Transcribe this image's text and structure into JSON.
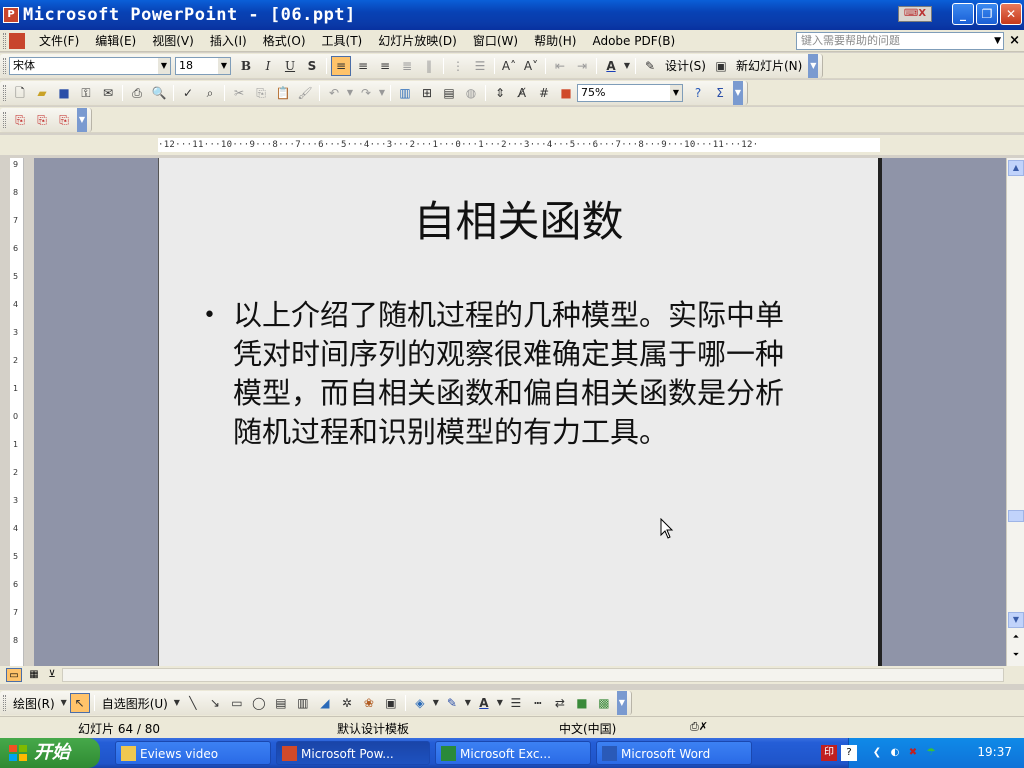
{
  "window": {
    "title": "Microsoft PowerPoint - [06.ppt]",
    "app_icon_label": "P",
    "ime_badge": "⌨X"
  },
  "menu": {
    "items": [
      "文件(F)",
      "编辑(E)",
      "视图(V)",
      "插入(I)",
      "格式(O)",
      "工具(T)",
      "幻灯片放映(D)",
      "窗口(W)",
      "帮助(H)",
      "Adobe PDF(B)"
    ],
    "help_placeholder": "键入需要帮助的问题"
  },
  "format_toolbar": {
    "font": "宋体",
    "size": "18",
    "design_label": "设计(S)",
    "new_slide_label": "新幻灯片(N)"
  },
  "standard_toolbar": {
    "zoom": "75%"
  },
  "ruler": {
    "text": "·12···11···10···9···8···7···6···5···4···3···2···1···0···1···2···3···4···5···6···7···8···9···10···11···12·",
    "vertical_marks": [
      "9",
      "8",
      "7",
      "6",
      "5",
      "4",
      "3",
      "2",
      "1",
      "0",
      "1",
      "2",
      "3",
      "4",
      "5",
      "6",
      "7",
      "8"
    ]
  },
  "slide": {
    "title": "自相关函数",
    "bullet": "•",
    "body": "以上介绍了随机过程的几种模型。实际中单凭对时间序列的观察很难确定其属于哪一种模型，而自相关函数和偏自相关函数是分析随机过程和识别模型的有力工具。"
  },
  "drawing_toolbar": {
    "draw_label": "绘图(R)",
    "autoshapes_label": "自选图形(U)"
  },
  "status": {
    "slide_counter": "幻灯片 64 / 80",
    "design_template": "默认设计模板",
    "language": "中文(中国)"
  },
  "taskbar": {
    "start_label": "开始",
    "tasks": [
      "Eviews video",
      "Microsoft Pow...",
      "Microsoft Exc...",
      "Microsoft Word"
    ],
    "clock": "19:37"
  },
  "colors": {
    "titlebar": "#0842b5",
    "workspace": "#8f94a8",
    "slide_bg": "#ebebeb",
    "taskbar": "#245ed7",
    "start_button": "#2f8a32"
  }
}
